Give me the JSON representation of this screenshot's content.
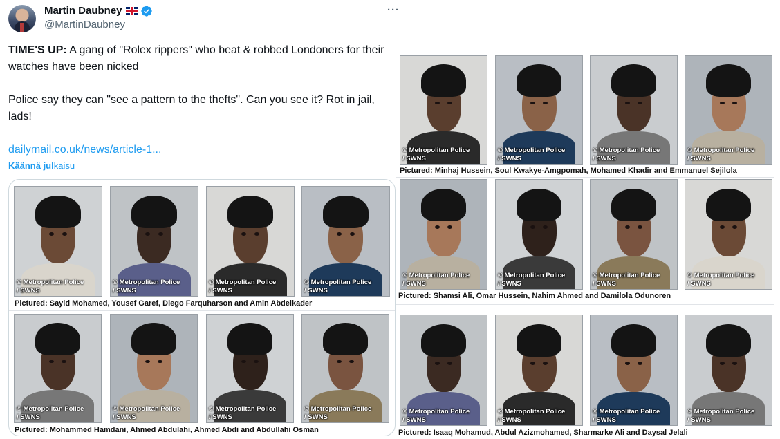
{
  "header": {
    "display_name": "Martin Daubney",
    "handle": "@MartinDaubney",
    "more_label": "···"
  },
  "tweet": {
    "line1_bold": "TIME'S UP:",
    "line1_rest": " A gang of \"Rolex rippers\" who beat & robbed Londoners for their watches have been nicked",
    "line2": "Police say they can \"see a pattern to the thefts\". Can you see it? Rot in jail, lads!",
    "link": "dailymail.co.uk/news/article-1...",
    "translate_bold": "Käännä jul",
    "translate_rest": "kaisu"
  },
  "watermark": {
    "source": "© Metropolitan Police",
    "agency": "/ SWNS"
  },
  "captions": {
    "left_top": "Pictured: Sayid Mohamed, Yousef Garef, Diego Farquharson and Amin Abdelkader",
    "left_bottom": "Pictured: Mohammed Hamdani, Ahmed Abdulahi, Ahmed Abdi and Abdullahi Osman",
    "right_top": "Pictured: Minhaj Hussein, Soul Kwakye-Amgpomah, Mohamed Khadir and Emmanuel Sejilola",
    "right_middle": "Pictured: Shamsi Ali, Omar Hussein, Nahim Ahmed and Damilola Odunoren",
    "right_bottom": "Pictured: Isaaq Mohamud, Abdul Azizmohamed, Sharmarke Ali and Daysal Jelali"
  },
  "colors": {
    "link": "#1d9bf0",
    "text": "#0f1419",
    "muted": "#536471",
    "verified": "#1d9bf0"
  }
}
